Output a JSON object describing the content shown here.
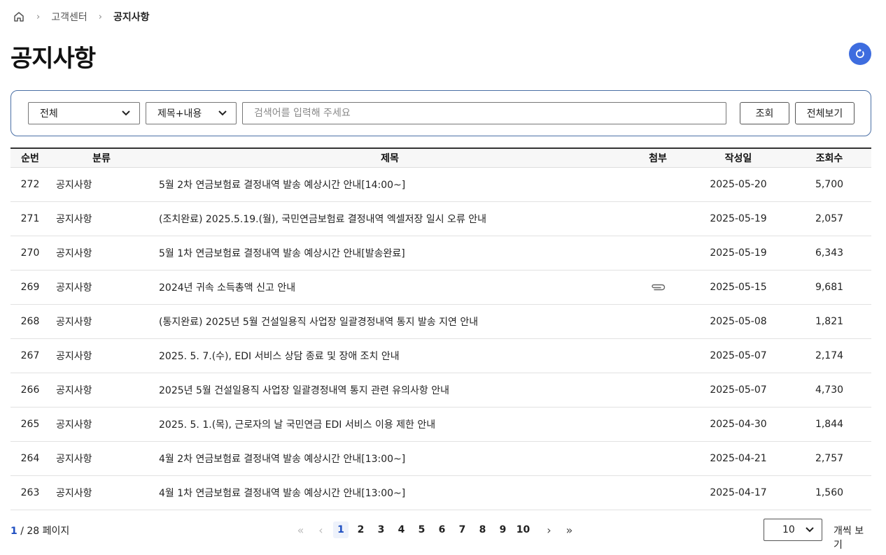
{
  "breadcrumb": {
    "items": [
      "고객센터",
      "공지사항"
    ]
  },
  "page": {
    "title": "공지사항"
  },
  "search": {
    "category_value": "전체",
    "field_value": "제목+내용",
    "placeholder": "검색어를 입력해 주세요",
    "search_label": "조회",
    "view_all_label": "전체보기"
  },
  "table": {
    "headers": {
      "no": "순번",
      "category": "분류",
      "title": "제목",
      "attachment": "첨부",
      "date": "작성일",
      "views": "조회수"
    },
    "rows": [
      {
        "no": "272",
        "category": "공지사항",
        "title": "5월 2차 연금보험료 결정내역 발송 예상시간 안내[14:00~]",
        "attachment": false,
        "date": "2025-05-20",
        "views": "5,700"
      },
      {
        "no": "271",
        "category": "공지사항",
        "title": "(조치완료) 2025.5.19.(월), 국민연금보험료 결정내역 엑셀저장 일시 오류 안내",
        "attachment": false,
        "date": "2025-05-19",
        "views": "2,057"
      },
      {
        "no": "270",
        "category": "공지사항",
        "title": "5월 1차 연금보험료 결정내역 발송 예상시간 안내[발송완료]",
        "attachment": false,
        "date": "2025-05-19",
        "views": "6,343"
      },
      {
        "no": "269",
        "category": "공지사항",
        "title": "2024년 귀속 소득총액 신고 안내",
        "attachment": true,
        "date": "2025-05-15",
        "views": "9,681"
      },
      {
        "no": "268",
        "category": "공지사항",
        "title": "(통지완료) 2025년 5월 건설일용직 사업장 일괄경정내역 통지 발송 지연 안내",
        "attachment": false,
        "date": "2025-05-08",
        "views": "1,821"
      },
      {
        "no": "267",
        "category": "공지사항",
        "title": "2025. 5. 7.(수), EDI 서비스 상담 종료 및 장애 조치 안내",
        "attachment": false,
        "date": "2025-05-07",
        "views": "2,174"
      },
      {
        "no": "266",
        "category": "공지사항",
        "title": "2025년 5월 건설일용직 사업장 일괄경정내역 통지 관련 유의사항 안내",
        "attachment": false,
        "date": "2025-05-07",
        "views": "4,730"
      },
      {
        "no": "265",
        "category": "공지사항",
        "title": "2025. 5. 1.(목), 근로자의 날 국민연금 EDI 서비스 이용 제한 안내",
        "attachment": false,
        "date": "2025-04-30",
        "views": "1,844"
      },
      {
        "no": "264",
        "category": "공지사항",
        "title": "4월 2차 연금보험료 결정내역 발송 예상시간 안내[13:00~]",
        "attachment": false,
        "date": "2025-04-21",
        "views": "2,757"
      },
      {
        "no": "263",
        "category": "공지사항",
        "title": "4월 1차 연금보험료 결정내역 발송 예상시간 안내[13:00~]",
        "attachment": false,
        "date": "2025-04-17",
        "views": "1,560"
      }
    ]
  },
  "pagination": {
    "current": "1",
    "separator": "/",
    "total": "28",
    "suffix": "페이지",
    "pages": [
      "1",
      "2",
      "3",
      "4",
      "5",
      "6",
      "7",
      "8",
      "9",
      "10"
    ],
    "per_page_value": "10",
    "per_page_label": "개씩 보기"
  },
  "colors": {
    "accent": "#3e6ddf",
    "search_border": "#4a6fa5",
    "current_page": "#1f4fc1"
  }
}
